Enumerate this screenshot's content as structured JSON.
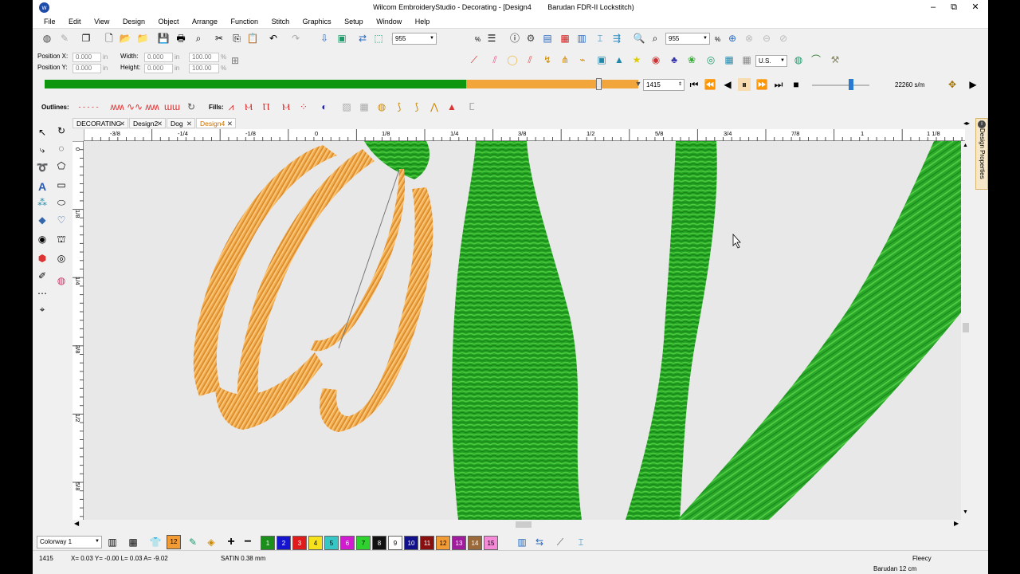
{
  "window": {
    "title_app": "Wilcom EmbroideryStudio - Decorating - [Design4",
    "title_machine": "Barudan FDR-II Lockstitch)",
    "minimize": "–",
    "restore": "⧉",
    "close": "✕"
  },
  "menu": [
    "File",
    "Edit",
    "View",
    "Design",
    "Object",
    "Arrange",
    "Function",
    "Stitch",
    "Graphics",
    "Setup",
    "Window",
    "Help"
  ],
  "toolbar": {
    "zoom1": "955",
    "zoom2": "955",
    "percent": "%",
    "units": "U.S."
  },
  "position": {
    "pos_x_label": "Position X:",
    "pos_y_label": "Position Y:",
    "width_label": "Width:",
    "height_label": "Height:",
    "x_val": "0.000",
    "y_val": "0.000",
    "w_val": "0.000",
    "h_val": "0.000",
    "unit": "in",
    "wpct": "100.00",
    "hpct": "100.00",
    "pct": "%"
  },
  "player": {
    "progress_fraction": 0.71,
    "stitch_number": "1415",
    "speed": "22260 s/m"
  },
  "outlines_fills": {
    "outlines_label": "Outlines:",
    "fills_label": "Fills:"
  },
  "tabs": [
    {
      "label": "DECORATING"
    },
    {
      "label": "Design2"
    },
    {
      "label": "Dog"
    },
    {
      "label": "Design4"
    }
  ],
  "tab_close": "✕",
  "ruler_top": [
    "-3/8",
    "-1/4",
    "-1/8",
    "0",
    "1/8",
    "1/4",
    "3/8",
    "1/2",
    "5/8",
    "3/4",
    "7/8",
    "1",
    "1 1/8"
  ],
  "ruler_left": [
    "0",
    "1/8",
    "1/4",
    "3/8",
    "1/2",
    "5/8"
  ],
  "right_panel": "Design Properties",
  "colorway": {
    "label": "Colorway 1",
    "swatches": [
      {
        "n": "1",
        "color": "#1a8f1a"
      },
      {
        "n": "2",
        "color": "#1515d0"
      },
      {
        "n": "3",
        "color": "#e01b1b"
      },
      {
        "n": "4",
        "color": "#f5e21c"
      },
      {
        "n": "5",
        "color": "#37c6c6"
      },
      {
        "n": "6",
        "color": "#d01bd0"
      },
      {
        "n": "7",
        "color": "#2ed12e"
      },
      {
        "n": "8",
        "color": "#111111"
      },
      {
        "n": "9",
        "color": "#ffffff"
      },
      {
        "n": "10",
        "color": "#10108a"
      },
      {
        "n": "11",
        "color": "#8a1010"
      },
      {
        "n": "12",
        "color": "#f29b35"
      },
      {
        "n": "13",
        "color": "#a01b9e"
      },
      {
        "n": "14",
        "color": "#9a6a3a"
      },
      {
        "n": "15",
        "color": "#f58bd8"
      }
    ]
  },
  "status": {
    "stitch": "1415",
    "coords": "X=  0.03 Y= -0.00 L=  0.03 A= -9.02",
    "stitch_type": "SATIN  0.38 mm",
    "fabric": "Fleecy",
    "hoop": "Barudan 12 cm"
  },
  "colors": {
    "green_thread": "#2fa62f",
    "orange_thread": "#f0a848",
    "progress_done": "#0f960f",
    "progress_remaining": "#f2a53a"
  }
}
